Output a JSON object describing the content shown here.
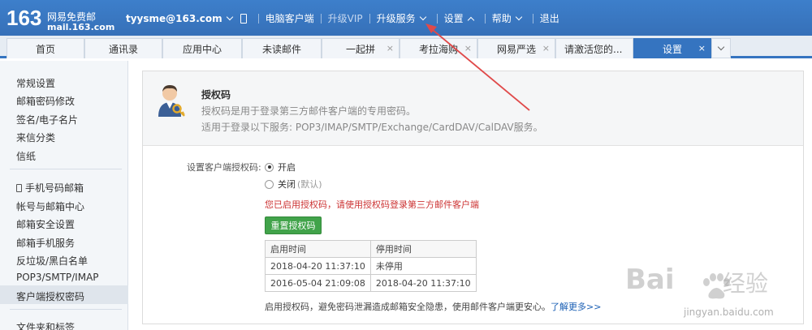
{
  "header": {
    "logo_number": "163",
    "logo_name": "网易免费邮",
    "logo_domain": "mail.163.com",
    "user": "tyysme@163.com",
    "nav": [
      {
        "label": "电脑客户端"
      },
      {
        "label": "升级VIP"
      },
      {
        "label": "升级服务"
      },
      {
        "label": "设置"
      },
      {
        "label": "帮助"
      },
      {
        "label": "退出"
      }
    ]
  },
  "tabs": [
    {
      "label": "首页"
    },
    {
      "label": "通讯录"
    },
    {
      "label": "应用中心"
    },
    {
      "label": "未读邮件"
    },
    {
      "label": "一起拼"
    },
    {
      "label": "考拉海购"
    },
    {
      "label": "网易严选"
    },
    {
      "label": "请激活您的..."
    },
    {
      "label": "设置"
    }
  ],
  "tab_close": "×",
  "sidebar": {
    "group1": [
      "常规设置",
      "邮箱密码修改",
      "签名/电子名片",
      "来信分类",
      "信纸"
    ],
    "group2": [
      "手机号码邮箱",
      "帐号与邮箱中心",
      "邮箱安全设置",
      "邮箱手机服务",
      "反垃圾/黑白名单",
      "POP3/SMTP/IMAP",
      "客户端授权密码"
    ],
    "group3": [
      "文件夹和标签"
    ]
  },
  "auth": {
    "title": "授权码",
    "desc1": "授权码是用于登录第三方邮件客户端的专用密码。",
    "desc2": "适用于登录以下服务: POP3/IMAP/SMTP/Exchange/CardDAV/CalDAV服务。",
    "icon": "user-key-icon"
  },
  "settings": {
    "label": "设置客户端授权码:",
    "on_label": "开启",
    "off_label": "关闭",
    "off_default": "(默认)",
    "selected": "开启",
    "warning": "您已启用授权码，请使用授权码登录第三方邮件客户端",
    "reset_button": "重置授权码"
  },
  "log_table": {
    "headers": [
      "启用时间",
      "停用时间"
    ],
    "rows": [
      [
        "2018-04-20 11:37:10",
        "未停用"
      ],
      [
        "2016-05-04 21:09:08",
        "2018-04-20 11:37:10"
      ]
    ]
  },
  "footer": {
    "text": "启用授权码，避免密码泄漏造成邮箱安全隐患，使用邮件客户端更安心。",
    "link": "了解更多>>"
  },
  "watermark": {
    "brand": "Bai",
    "brand2": "经验",
    "url": "jingyan.baidu.com"
  },
  "colors": {
    "header": "#3a78c3",
    "active_tab": "#3574c0",
    "button": "#41a34a",
    "warning": "#cc3333",
    "annotation_arrow": "#e04a4a"
  }
}
